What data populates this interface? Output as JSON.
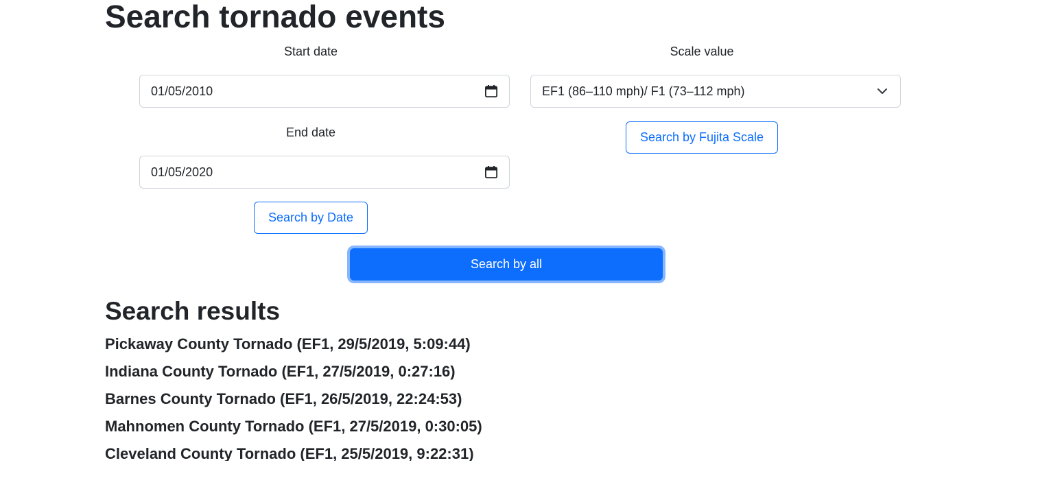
{
  "page": {
    "title": "Search tornado events"
  },
  "date_search": {
    "start_label": "Start date",
    "start_value": "01/05/2010",
    "end_label": "End date",
    "end_value": "01/05/2020",
    "button_label": "Search by Date"
  },
  "scale_search": {
    "label": "Scale value",
    "selected": "EF1 (86–110 mph)/ F1 (73–112 mph)",
    "button_label": "Search by Fujita Scale"
  },
  "search_all": {
    "button_label": "Search by all"
  },
  "results": {
    "heading": "Search results",
    "items": [
      "Pickaway County Tornado (EF1, 29/5/2019, 5:09:44)",
      "Indiana County Tornado (EF1, 27/5/2019, 0:27:16)",
      "Barnes County Tornado (EF1, 26/5/2019, 22:24:53)",
      "Mahnomen County Tornado (EF1, 27/5/2019, 0:30:05)",
      "Cleveland County Tornado (EF1, 25/5/2019, 9:22:31)"
    ]
  },
  "icons": {
    "date_picker": "calendar-icon",
    "dropdown": "chevron-down-icon"
  },
  "colors": {
    "primary": "#0d6efd",
    "text": "#212529",
    "border": "#ced4da"
  }
}
